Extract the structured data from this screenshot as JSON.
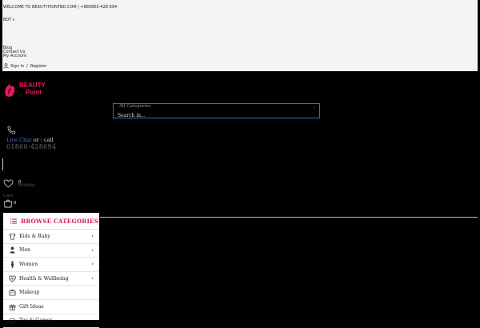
{
  "topbar": {
    "welcome": "WELCOME TO BEAUTYPOINTBD.COM | +880860-428 694",
    "currency": "BDT ৳",
    "links": [
      "Blog",
      "Contact Us",
      "My Account"
    ],
    "sign_in": "Sign In",
    "separator": "/",
    "register": "Register"
  },
  "logo": {
    "line1": "BEAUTY",
    "line2": "Point",
    "color": "#e8175d"
  },
  "search": {
    "category": "All Categories",
    "placeholder": "Search in..."
  },
  "contact": {
    "live_chat": "Live Chat",
    "or_call": " or : call",
    "phone": "01860-428694"
  },
  "wishlist": {
    "count": "0",
    "label": "Wishlist"
  },
  "cart": {
    "label": "Cart",
    "count": "0"
  },
  "categories": {
    "title": "BROWSE CATEGORIES",
    "items": [
      {
        "label": "Kids & Baby",
        "icon": "baby-clothes-icon",
        "has_submenu": true
      },
      {
        "label": "Men",
        "icon": "man-icon",
        "has_submenu": true
      },
      {
        "label": "Women",
        "icon": "woman-icon",
        "has_submenu": true
      },
      {
        "label": "Health & Wellbeing",
        "icon": "heart-pulse-icon",
        "has_submenu": true
      },
      {
        "label": "Makeup",
        "icon": "makeup-case-icon",
        "has_submenu": false
      },
      {
        "label": "Gift Ideas",
        "icon": "gift-icon",
        "has_submenu": false
      },
      {
        "label": "Toy & Games",
        "icon": "toy-icon",
        "has_submenu": false
      }
    ]
  },
  "colors": {
    "accent": "#d11e5f",
    "link": "#3d78e0",
    "search_border": "#2e6fd8"
  }
}
